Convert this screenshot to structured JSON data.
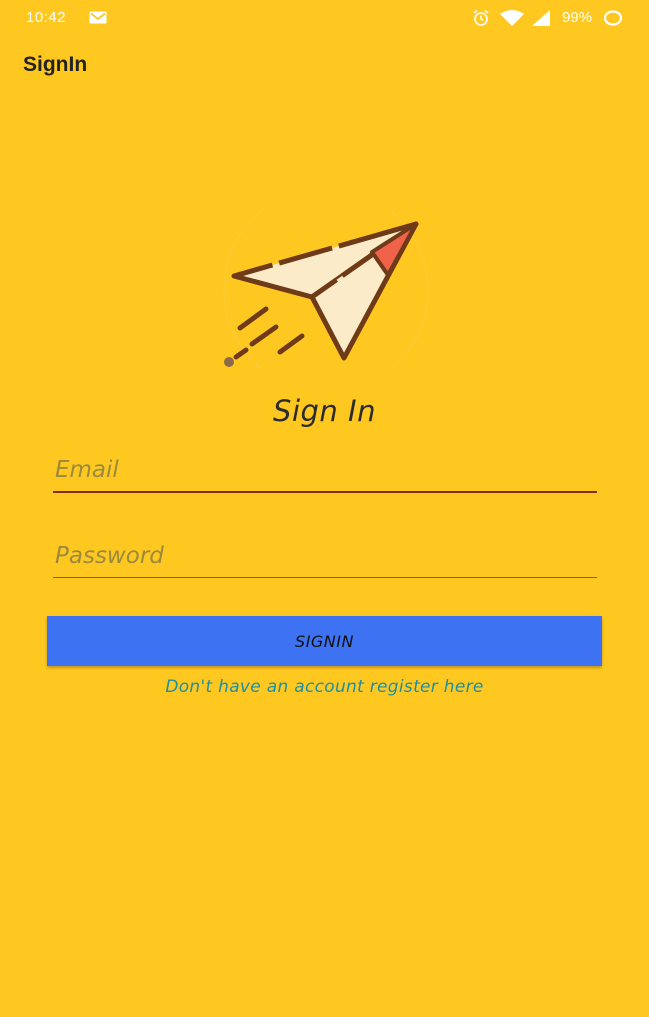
{
  "status_bar": {
    "time": "10:42",
    "battery_percent": "99%",
    "icons": [
      "mail-icon",
      "alarm-icon",
      "wifi-icon",
      "signal-icon",
      "battery-icon"
    ]
  },
  "app_bar": {
    "title": "SignIn"
  },
  "logo": {
    "icon": "paper-plane-icon"
  },
  "form": {
    "heading": "Sign In",
    "email": {
      "placeholder": "Email",
      "value": ""
    },
    "password": {
      "placeholder": "Password",
      "value": ""
    },
    "signin_label": "SIGNIN",
    "register_link": "Don't have an account register here"
  },
  "colors": {
    "background": "#FFC821",
    "button": "#3D72F2",
    "link": "#1F8FA0",
    "email_underline": "#8a2a10"
  }
}
